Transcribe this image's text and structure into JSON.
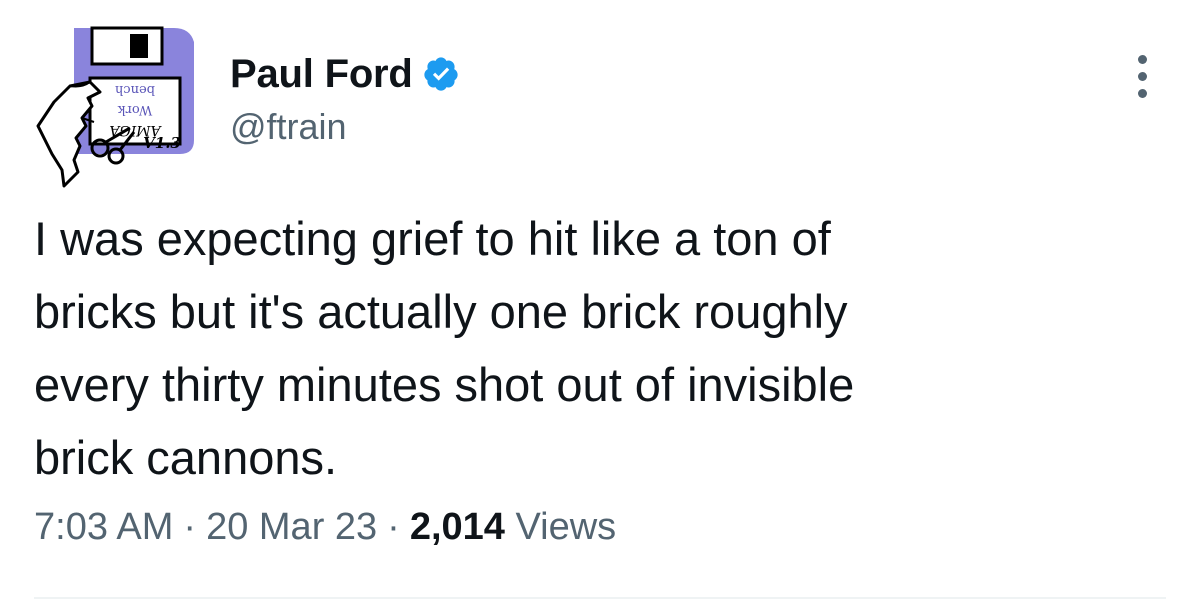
{
  "author": {
    "display_name": "Paul Ford",
    "handle": "@ftrain",
    "verified": true,
    "avatar_icon": "amiga-workbench-disk-icon",
    "avatar_text": {
      "line1": "bench",
      "line2": "Work",
      "line3": "AMIGA",
      "version": "V1.3"
    }
  },
  "tweet": {
    "text": "I was expecting grief to hit like a ton of\nbricks but it's actually one brick roughly\nevery thirty minutes shot out of invisible\nbrick cannons."
  },
  "meta": {
    "time": "7:03 AM",
    "separator": "·",
    "date": "20 Mar 23",
    "views_count": "2,014",
    "views_label": "Views"
  },
  "colors": {
    "text_primary": "#0f1419",
    "text_secondary": "#536471",
    "verified_blue": "#1d9bf0",
    "avatar_purple": "#8a84dc"
  }
}
